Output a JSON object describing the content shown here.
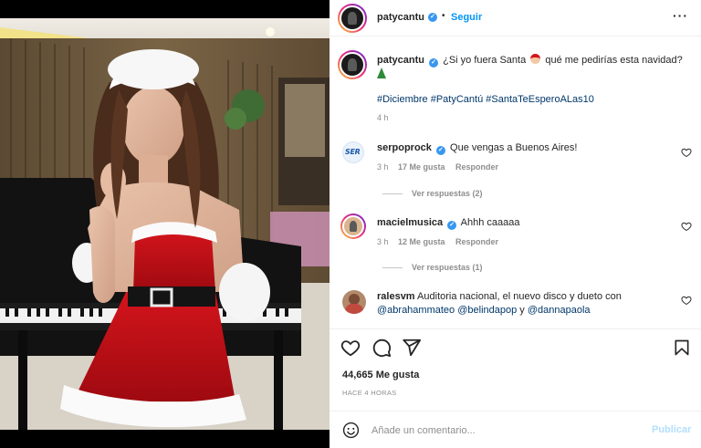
{
  "post": {
    "author": "patycantu",
    "follow_label": "Seguir",
    "caption": "¿Si yo fuera Santa",
    "caption_2": "qué me pedirías esta navidad?",
    "hashtags": [
      "#Diciembre",
      "#PatyCantú",
      "#SantaTeEsperoALas10"
    ],
    "caption_time": "4 h"
  },
  "comments": [
    {
      "user": "serpoprock",
      "text": "Que vengas a Buenos Aires!",
      "time": "3 h",
      "likes": "17 Me gusta",
      "reply": "Responder",
      "view_replies": "Ver respuestas (2)"
    },
    {
      "user": "macielmusica",
      "text": "Ahhh caaaaa",
      "time": "3 h",
      "likes": "12 Me gusta",
      "reply": "Responder",
      "view_replies": "Ver respuestas (1)"
    },
    {
      "user": "ralesvm",
      "text": "Auditoria nacional, el nuevo disco y dueto con",
      "mentions": [
        "@abrahammateo",
        "@belindapop",
        "@dannapaola"
      ],
      "joiner": "y"
    }
  ],
  "stats": {
    "likes": "44,665 Me gusta",
    "ago": "HACE 4 HORAS"
  },
  "composer": {
    "placeholder": "Añade un comentario...",
    "publish": "Publicar"
  },
  "icons": {
    "verified": "verified-badge-icon",
    "like": "heart-outline-icon",
    "comment": "comment-bubble-icon",
    "share": "paper-plane-icon",
    "save": "bookmark-icon",
    "emoji": "emoji-smile-icon",
    "more": "more-dots-icon"
  },
  "colors": {
    "accent": "#0095f6",
    "hashtag": "#00376b",
    "muted": "#8e8e8e",
    "publish_disabled": "#b2dffc",
    "verified": "#3897f0"
  }
}
